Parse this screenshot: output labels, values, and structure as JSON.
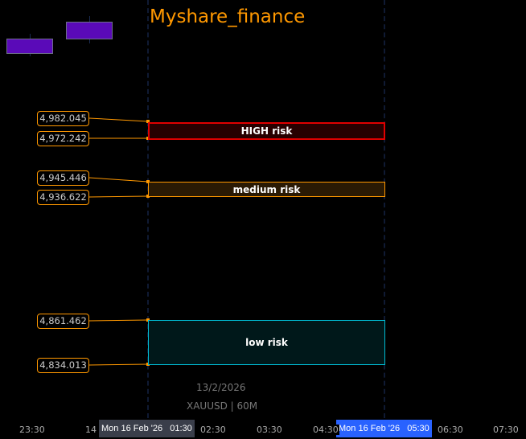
{
  "title": "Myshare_finance",
  "colors": {
    "accent": "#ff9800",
    "high": "#e00000",
    "medium": "#ff9800",
    "low": "#00bcd4",
    "candle": "#5a0ab8",
    "highlight_blue": "#2962ff",
    "highlight_gray": "#3a3e4a"
  },
  "price_labels": [
    "4,982.045",
    "4,972.242",
    "4,945.446",
    "4,936.622",
    "4,861.462",
    "4,834.013"
  ],
  "zones": {
    "high": "HIGH risk",
    "medium": "medium risk",
    "low": "low risk"
  },
  "caption": {
    "date": "13/2/2026",
    "symbol": "XAUUSD | 60M"
  },
  "time_axis": {
    "ticks": [
      "23:30",
      "14",
      "02:30",
      "03:30",
      "04:30",
      "06:30",
      "07:30"
    ],
    "crosshair_left": "Mon 16 Feb '26   01:30",
    "crosshair_right": "Mon 16 Feb '26   05:30"
  }
}
